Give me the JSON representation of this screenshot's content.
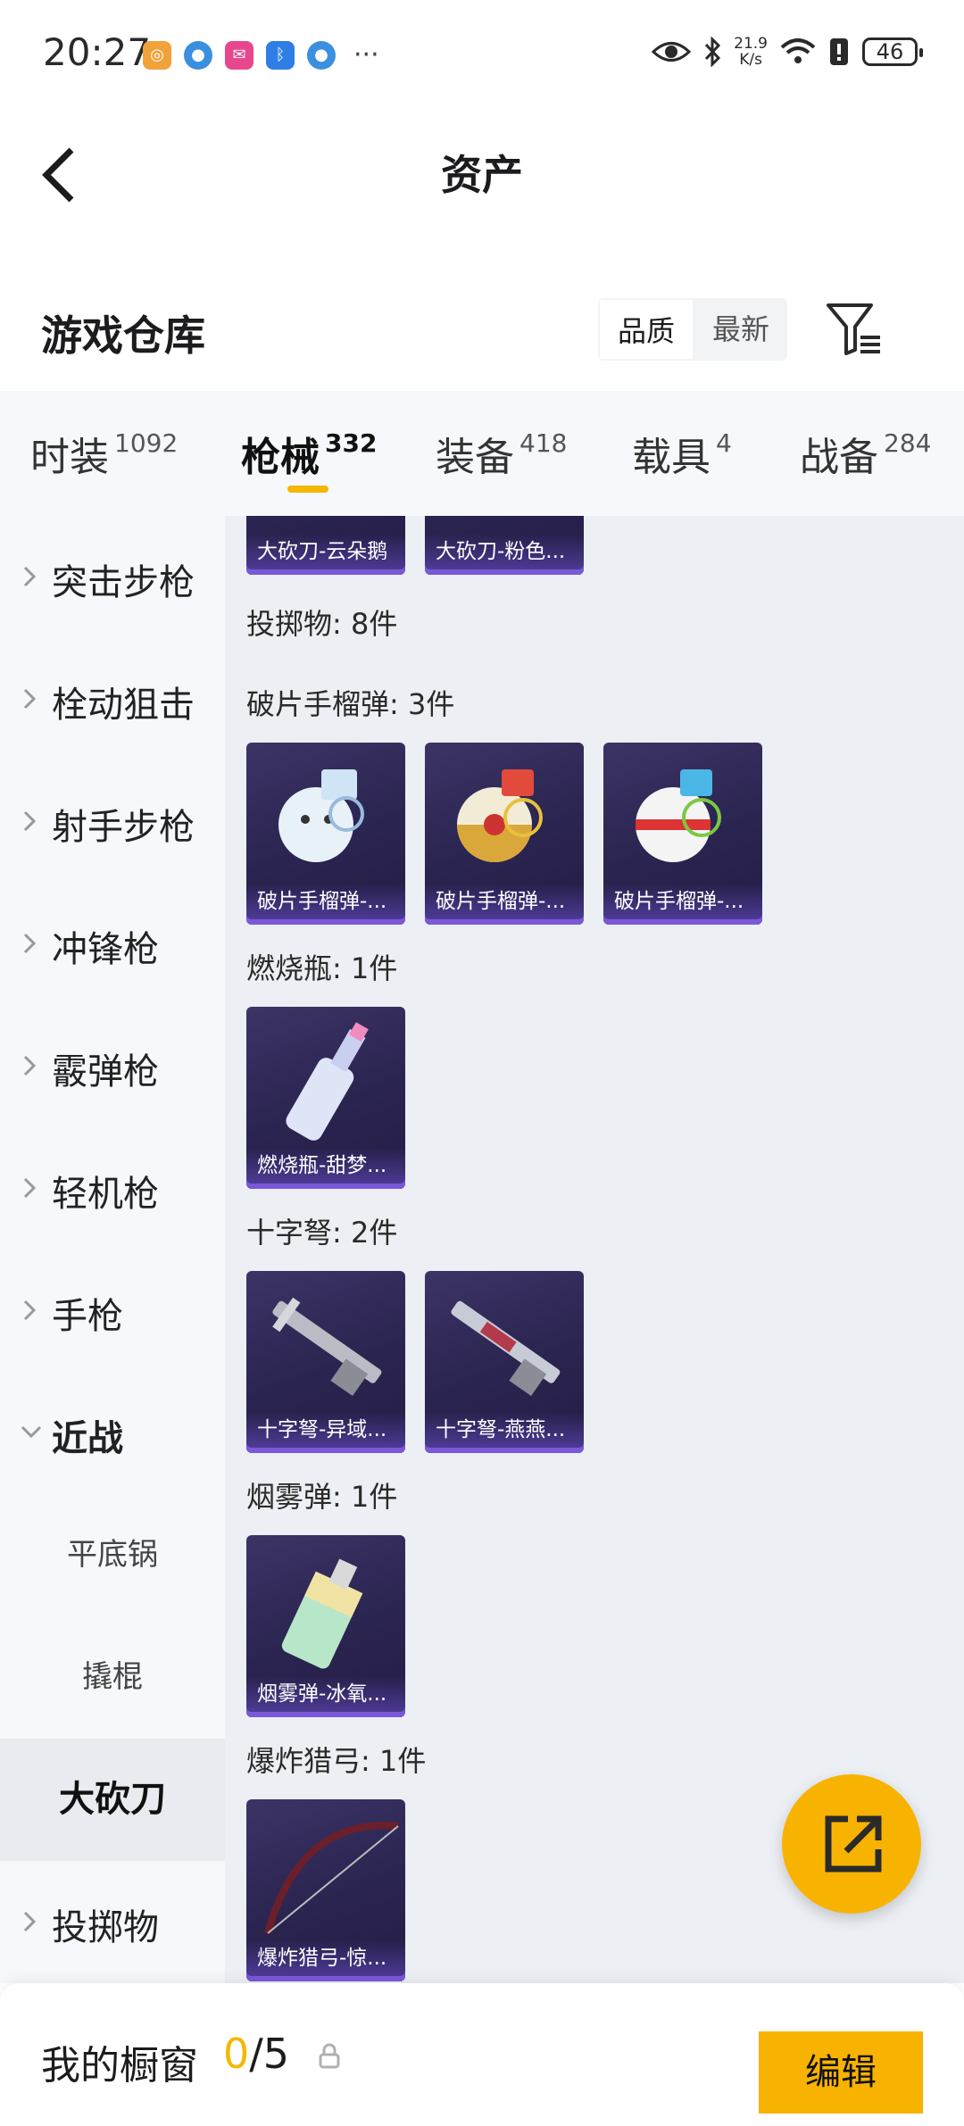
{
  "status_bar": {
    "time": "20:27",
    "speed_value": "21.9",
    "speed_unit": "K/s",
    "battery": "46"
  },
  "header": {
    "title": "资产"
  },
  "warehouse": {
    "title": "游戏仓库",
    "sort_options": [
      "品质",
      "最新"
    ]
  },
  "tabs": [
    {
      "label": "时装",
      "count": "1092"
    },
    {
      "label": "枪械",
      "count": "332"
    },
    {
      "label": "装备",
      "count": "418"
    },
    {
      "label": "载具",
      "count": "4"
    },
    {
      "label": "战备",
      "count": "284"
    }
  ],
  "sidebar": {
    "items": [
      "突击步枪",
      "栓动狙击",
      "射手步枪",
      "冲锋枪",
      "霰弹枪",
      "轻机枪",
      "手枪",
      "近战",
      "投掷物"
    ],
    "sub_items": [
      "平底锅",
      "撬棍",
      "大砍刀"
    ]
  },
  "content": {
    "top_cards": [
      "大砍刀-云朵鹅",
      "大砍刀-粉色..."
    ],
    "throwables_header": "投掷物: 8件",
    "sections": [
      {
        "title": "破片手榴弹: 3件",
        "items": [
          "破片手榴弹-...",
          "破片手榴弹-...",
          "破片手榴弹-..."
        ]
      },
      {
        "title": "燃烧瓶: 1件",
        "items": [
          "燃烧瓶-甜梦..."
        ]
      },
      {
        "title": "十字弩: 2件",
        "items": [
          "十字弩-异域...",
          "十字弩-燕燕..."
        ]
      },
      {
        "title": "烟雾弹: 1件",
        "items": [
          "烟雾弹-冰氧..."
        ]
      },
      {
        "title": "爆炸猎弓: 1件",
        "items": [
          "爆炸猎弓-惊..."
        ]
      }
    ]
  },
  "bottom_bar": {
    "label": "我的橱窗",
    "count_current": "0",
    "count_total": "/5",
    "edit_label": "编辑"
  },
  "colors": {
    "accent": "#f8b300",
    "card_bg": "#2a2450",
    "sidebar_bg": "#f6f8fb",
    "content_bg": "#eceff3"
  }
}
